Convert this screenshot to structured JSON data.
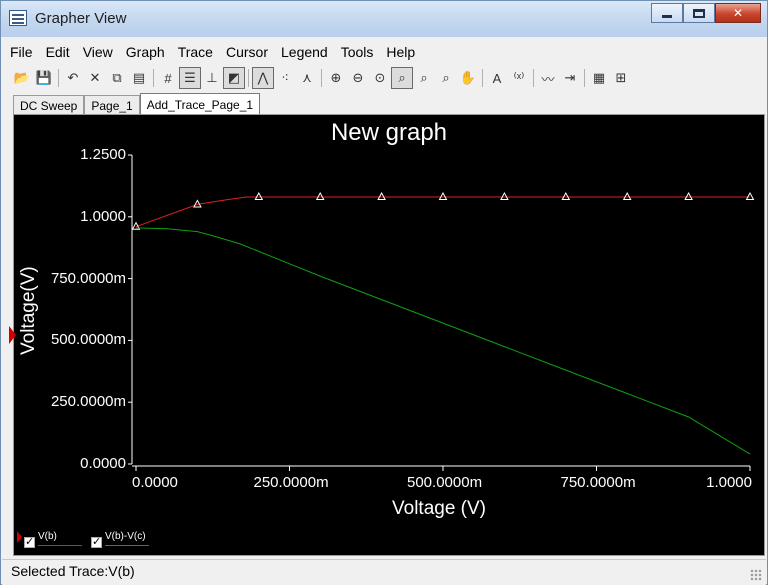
{
  "window": {
    "title": "Grapher View"
  },
  "menu": [
    "File",
    "Edit",
    "View",
    "Graph",
    "Trace",
    "Cursor",
    "Legend",
    "Tools",
    "Help"
  ],
  "toolbar": [
    {
      "icon": "open-folder-icon",
      "glyph": "📂"
    },
    {
      "icon": "save-icon",
      "glyph": "💾"
    },
    {
      "sep": true
    },
    {
      "icon": "undo-icon",
      "glyph": "↶"
    },
    {
      "icon": "delete-icon",
      "glyph": "✕"
    },
    {
      "icon": "copy-icon",
      "glyph": "⧉"
    },
    {
      "icon": "paste-icon",
      "glyph": "▤"
    },
    {
      "sep": true
    },
    {
      "icon": "grid-icon",
      "glyph": "#"
    },
    {
      "icon": "legend-icon",
      "glyph": "☰",
      "pressed": true
    },
    {
      "icon": "ticks-icon",
      "glyph": "⊥"
    },
    {
      "icon": "invert-icon",
      "glyph": "◩",
      "pressed": true
    },
    {
      "sep": true
    },
    {
      "icon": "show-lines-icon",
      "glyph": "⋀",
      "pressed": true
    },
    {
      "icon": "show-points-icon",
      "glyph": "⁖"
    },
    {
      "icon": "lines-points-icon",
      "glyph": "⋏"
    },
    {
      "sep": true
    },
    {
      "icon": "zoom-in-icon",
      "glyph": "⊕"
    },
    {
      "icon": "zoom-out-icon",
      "glyph": "⊖"
    },
    {
      "icon": "zoom-reset-icon",
      "glyph": "⊙"
    },
    {
      "icon": "zoom-area-icon",
      "glyph": "⌕",
      "pressed": true
    },
    {
      "icon": "zoom-x-icon",
      "glyph": "⌕"
    },
    {
      "icon": "zoom-y-icon",
      "glyph": "⌕"
    },
    {
      "icon": "pan-hand-icon",
      "glyph": "✋"
    },
    {
      "sep": true
    },
    {
      "icon": "text-annotation-icon",
      "glyph": "A"
    },
    {
      "icon": "data-label-icon",
      "glyph": "⁽ˣ⁾"
    },
    {
      "sep": true
    },
    {
      "icon": "cursors-icon",
      "glyph": "〰"
    },
    {
      "icon": "export-icon",
      "glyph": "⇥"
    },
    {
      "sep": true
    },
    {
      "icon": "properties-icon",
      "glyph": "▦"
    },
    {
      "icon": "overlay-icon",
      "glyph": "⊞"
    }
  ],
  "tabs": [
    {
      "label": "DC Sweep",
      "active": false
    },
    {
      "label": "Page_1",
      "active": false
    },
    {
      "label": "Add_Trace_Page_1",
      "active": true
    }
  ],
  "colors": {
    "plot_bg": "#000000",
    "trace_vb": "#e02020",
    "trace_vbc": "#10a010",
    "axis": "#ffffff"
  },
  "chart_data": {
    "type": "line",
    "title": "New graph",
    "xlabel": "Voltage (V)",
    "ylabel": "Voltage(V)",
    "xlim": [
      0,
      1
    ],
    "ylim": [
      0,
      1.25
    ],
    "x_ticks": [
      {
        "value": 0,
        "label": "0.0000"
      },
      {
        "value": 0.25,
        "label": "250.0000m"
      },
      {
        "value": 0.5,
        "label": "500.0000m"
      },
      {
        "value": 0.75,
        "label": "750.0000m"
      },
      {
        "value": 1,
        "label": "1.0000"
      }
    ],
    "y_ticks": [
      {
        "value": 0,
        "label": "0.0000"
      },
      {
        "value": 0.25,
        "label": "250.0000m"
      },
      {
        "value": 0.5,
        "label": "500.0000m"
      },
      {
        "value": 0.75,
        "label": "750.0000m"
      },
      {
        "value": 1.0,
        "label": "1.0000"
      },
      {
        "value": 1.25,
        "label": "1.2500"
      }
    ],
    "grid": false,
    "legend_position": "bottom-left",
    "series": [
      {
        "name": "V(b)",
        "color": "#e02020",
        "markers": "triangle",
        "selected": true,
        "x": [
          0,
          0.1,
          0.15,
          0.18,
          0.2,
          0.3,
          0.4,
          0.5,
          0.6,
          0.7,
          0.8,
          0.9,
          1.0
        ],
        "y": [
          0.96,
          1.05,
          1.07,
          1.08,
          1.08,
          1.08,
          1.08,
          1.08,
          1.08,
          1.08,
          1.08,
          1.08,
          1.08
        ],
        "marker_indices": [
          0,
          1,
          4,
          5,
          6,
          7,
          8,
          9,
          10,
          11,
          12
        ]
      },
      {
        "name": "V(b)-V(c)",
        "color": "#10a010",
        "markers": "none",
        "selected": false,
        "x": [
          0,
          0.05,
          0.1,
          0.13,
          0.17,
          0.2,
          0.25,
          0.3,
          0.4,
          0.5,
          0.6,
          0.7,
          0.8,
          0.9,
          1.0
        ],
        "y": [
          0.955,
          0.952,
          0.94,
          0.92,
          0.89,
          0.86,
          0.81,
          0.76,
          0.665,
          0.57,
          0.475,
          0.38,
          0.285,
          0.19,
          0.04
        ]
      }
    ]
  },
  "status": {
    "text": "Selected Trace:V(b)"
  }
}
